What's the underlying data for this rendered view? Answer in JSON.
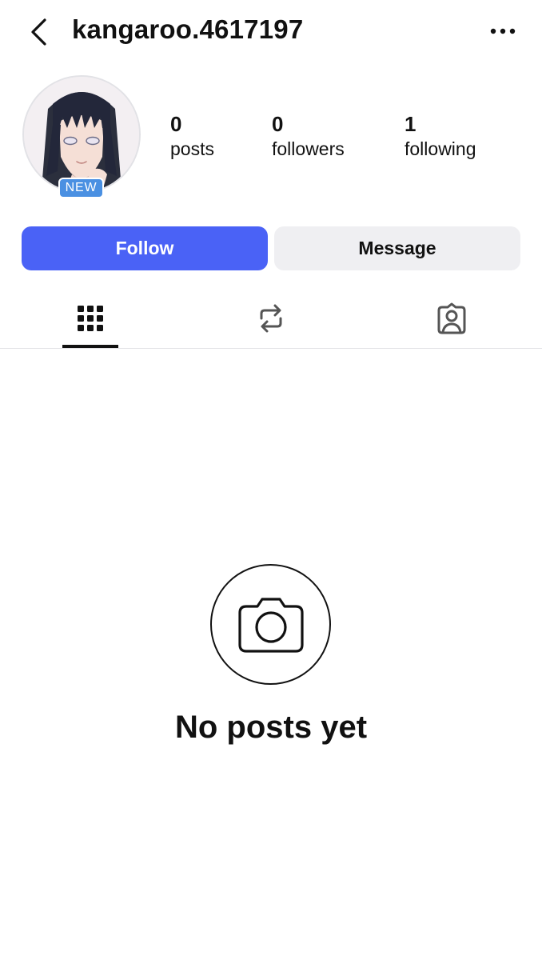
{
  "header": {
    "username": "kangaroo.4617197",
    "back_icon": "chevron-left-icon",
    "more_icon": "more-horizontal-icon"
  },
  "profile": {
    "badge": "NEW",
    "stats": [
      {
        "value": "0",
        "label": "posts"
      },
      {
        "value": "0",
        "label": "followers"
      },
      {
        "value": "1",
        "label": "following"
      }
    ]
  },
  "actions": {
    "follow_label": "Follow",
    "message_label": "Message"
  },
  "tabs": [
    {
      "icon": "grid-icon",
      "active": true
    },
    {
      "icon": "repost-icon",
      "active": false
    },
    {
      "icon": "tagged-user-icon",
      "active": false
    }
  ],
  "empty_state": {
    "icon": "camera-icon",
    "text": "No posts yet"
  },
  "colors": {
    "accent": "#4a62f6",
    "badge": "#4a90e2",
    "secondary_button": "#efeff2",
    "text": "#111111"
  }
}
